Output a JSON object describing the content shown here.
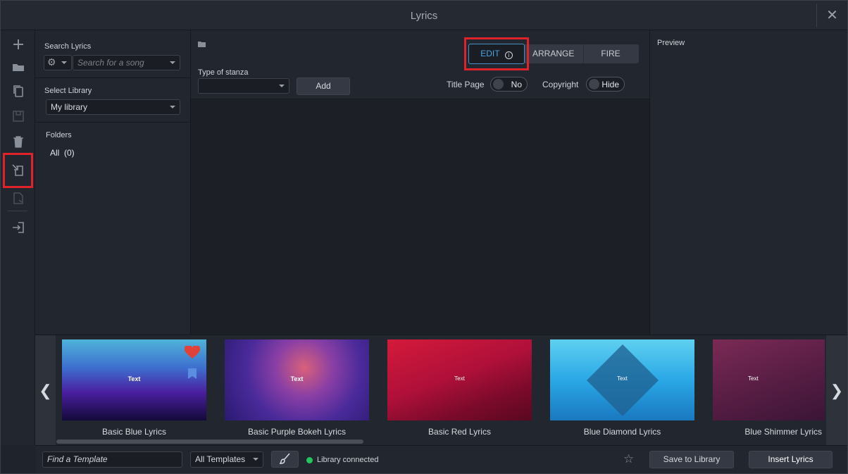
{
  "window": {
    "title": "Lyrics",
    "close_glyph": "✕"
  },
  "toolbar": {
    "icons": [
      "plus-icon",
      "folder-icon",
      "copy-icon",
      "save-icon",
      "trash-icon",
      "import-lyrics-icon",
      "export-icon",
      "sign-in-icon"
    ]
  },
  "left": {
    "search_label": "Search Lyrics",
    "search_placeholder": "Search for a song",
    "library_label": "Select Library",
    "library_value": "My library",
    "folders_label": "Folders",
    "folder_all": "All",
    "folder_all_count": "(0)"
  },
  "editor": {
    "stanza_label": "Type of stanza",
    "stanza_value": "",
    "add_label": "Add",
    "mode_tabs": {
      "edit": "EDIT",
      "arrange": "ARRANGE",
      "fire": "FIRE"
    },
    "title_page_label": "Title Page",
    "title_page_value": "No",
    "copyright_label": "Copyright",
    "copyright_value": "Hide"
  },
  "preview": {
    "label": "Preview"
  },
  "templates": {
    "items": [
      {
        "name": "Basic Blue Lyrics",
        "text": "Text"
      },
      {
        "name": "Basic Purple Bokeh Lyrics",
        "text": "Text"
      },
      {
        "name": "Basic Red Lyrics",
        "text": "Text"
      },
      {
        "name": "Blue Diamond Lyrics",
        "text": "Text"
      },
      {
        "name": "Blue Shimmer Lyrics",
        "text": "Text"
      }
    ]
  },
  "footer": {
    "find_placeholder": "Find a Template",
    "filter_value": "All Templates",
    "status": "Library connected",
    "save_label": "Save to Library",
    "insert_label": "Insert Lyrics"
  },
  "colors": {
    "accent": "#4aa3e6",
    "highlight": "#e0232b",
    "status_ok": "#22c55e"
  }
}
